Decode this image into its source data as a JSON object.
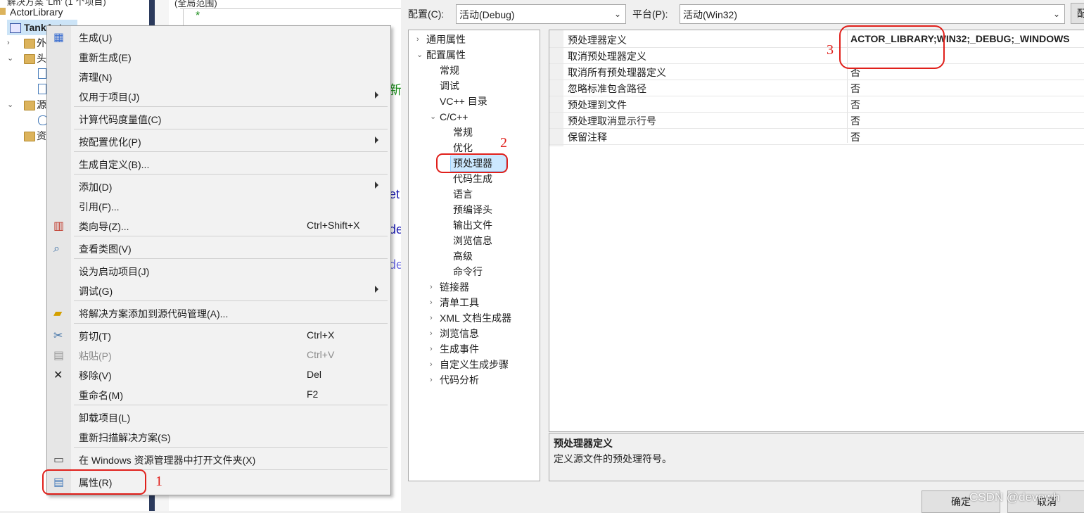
{
  "solution": {
    "header_text": "解决方案 'Lm' (1 个项目)",
    "items": [
      {
        "label": "ActorLibrary"
      },
      {
        "label": "TankActor"
      },
      {
        "label": "外"
      },
      {
        "label": "头"
      },
      {
        "label": "源"
      },
      {
        "label": "资"
      }
    ]
  },
  "editor": {
    "header": "(全局范围)",
    "star": "*",
    "fragments": [
      "新",
      "et",
      "de",
      "de"
    ]
  },
  "context_menu": {
    "items": [
      {
        "label": "生成(U)",
        "shortcut": "",
        "submenu": false,
        "icon": "build-icon",
        "disabled": false
      },
      {
        "label": "重新生成(E)",
        "shortcut": "",
        "submenu": false,
        "icon": "",
        "disabled": false
      },
      {
        "label": "清理(N)",
        "shortcut": "",
        "submenu": false,
        "icon": "",
        "disabled": false
      },
      {
        "label": "仅用于项目(J)",
        "shortcut": "",
        "submenu": true,
        "icon": "",
        "disabled": false
      },
      {
        "label": "计算代码度量值(C)",
        "shortcut": "",
        "submenu": false,
        "icon": "",
        "disabled": false
      },
      {
        "label": "按配置优化(P)",
        "shortcut": "",
        "submenu": true,
        "icon": "",
        "disabled": false
      },
      {
        "label": "生成自定义(B)...",
        "shortcut": "",
        "submenu": false,
        "icon": "",
        "disabled": false
      },
      {
        "label": "添加(D)",
        "shortcut": "",
        "submenu": true,
        "icon": "",
        "disabled": false
      },
      {
        "label": "引用(F)...",
        "shortcut": "",
        "submenu": false,
        "icon": "",
        "disabled": false
      },
      {
        "label": "类向导(Z)...",
        "shortcut": "Ctrl+Shift+X",
        "submenu": false,
        "icon": "class-wizard-icon",
        "disabled": false
      },
      {
        "label": "查看类图(V)",
        "shortcut": "",
        "submenu": false,
        "icon": "class-diagram-icon",
        "disabled": false
      },
      {
        "label": "设为启动项目(J)",
        "shortcut": "",
        "submenu": false,
        "icon": "",
        "disabled": false
      },
      {
        "label": "调试(G)",
        "shortcut": "",
        "submenu": true,
        "icon": "",
        "disabled": false
      },
      {
        "label": "将解决方案添加到源代码管理(A)...",
        "shortcut": "",
        "submenu": false,
        "icon": "add-source-control-icon",
        "disabled": false
      },
      {
        "label": "剪切(T)",
        "shortcut": "Ctrl+X",
        "submenu": false,
        "icon": "cut-icon",
        "disabled": false
      },
      {
        "label": "粘贴(P)",
        "shortcut": "Ctrl+V",
        "submenu": false,
        "icon": "paste-icon",
        "disabled": true
      },
      {
        "label": "移除(V)",
        "shortcut": "Del",
        "submenu": false,
        "icon": "remove-icon",
        "disabled": false
      },
      {
        "label": "重命名(M)",
        "shortcut": "F2",
        "submenu": false,
        "icon": "",
        "disabled": false
      },
      {
        "label": "卸载项目(L)",
        "shortcut": "",
        "submenu": false,
        "icon": "",
        "disabled": false
      },
      {
        "label": "重新扫描解决方案(S)",
        "shortcut": "",
        "submenu": false,
        "icon": "",
        "disabled": false
      },
      {
        "label": "在 Windows 资源管理器中打开文件夹(X)",
        "shortcut": "",
        "submenu": false,
        "icon": "open-folder-icon",
        "disabled": false
      },
      {
        "label": "属性(R)",
        "shortcut": "",
        "submenu": false,
        "icon": "properties-icon",
        "disabled": false
      }
    ]
  },
  "dialog": {
    "config_label": "配置(C):",
    "config_value": "活动(Debug)",
    "platform_label": "平台(P):",
    "platform_value": "活动(Win32)",
    "config_manager_partial": "配",
    "nav": [
      {
        "label": "通用属性",
        "chev": "›"
      },
      {
        "label": "配置属性",
        "chev": "⌄"
      },
      {
        "label": "常规",
        "chev": ""
      },
      {
        "label": "调试",
        "chev": ""
      },
      {
        "label": "VC++ 目录",
        "chev": ""
      },
      {
        "label": "C/C++",
        "chev": "⌄"
      },
      {
        "label": "常规",
        "chev": ""
      },
      {
        "label": "优化",
        "chev": ""
      },
      {
        "label": "预处理器",
        "chev": ""
      },
      {
        "label": "代码生成",
        "chev": ""
      },
      {
        "label": "语言",
        "chev": ""
      },
      {
        "label": "预编译头",
        "chev": ""
      },
      {
        "label": "输出文件",
        "chev": ""
      },
      {
        "label": "浏览信息",
        "chev": ""
      },
      {
        "label": "高级",
        "chev": ""
      },
      {
        "label": "命令行",
        "chev": ""
      },
      {
        "label": "链接器",
        "chev": "›"
      },
      {
        "label": "清单工具",
        "chev": "›"
      },
      {
        "label": "XML 文档生成器",
        "chev": "›"
      },
      {
        "label": "浏览信息",
        "chev": "›"
      },
      {
        "label": "生成事件",
        "chev": "›"
      },
      {
        "label": "自定义生成步骤",
        "chev": "›"
      },
      {
        "label": "代码分析",
        "chev": "›"
      }
    ],
    "properties": [
      {
        "key": "预处理器定义",
        "value": "ACTOR_LIBRARY;WIN32;_DEBUG;_WINDOWS"
      },
      {
        "key": "取消预处理器定义",
        "value": ""
      },
      {
        "key": "取消所有预处理器定义",
        "value": "否"
      },
      {
        "key": "忽略标准包含路径",
        "value": "否"
      },
      {
        "key": "预处理到文件",
        "value": "否"
      },
      {
        "key": "预处理取消显示行号",
        "value": "否"
      },
      {
        "key": "保留注释",
        "value": "否"
      }
    ],
    "description_title": "预处理器定义",
    "description_text": "定义源文件的预处理符号。",
    "ok_button": "确定",
    "cancel_button": "取消"
  },
  "annotations": {
    "one": "1",
    "two": "2",
    "three": "3"
  },
  "watermark": "CSDN @devewh",
  "colors": {
    "accent": "#e0201b",
    "selection": "#cce8ff",
    "sidebar_bar": "#2b3a5c"
  }
}
